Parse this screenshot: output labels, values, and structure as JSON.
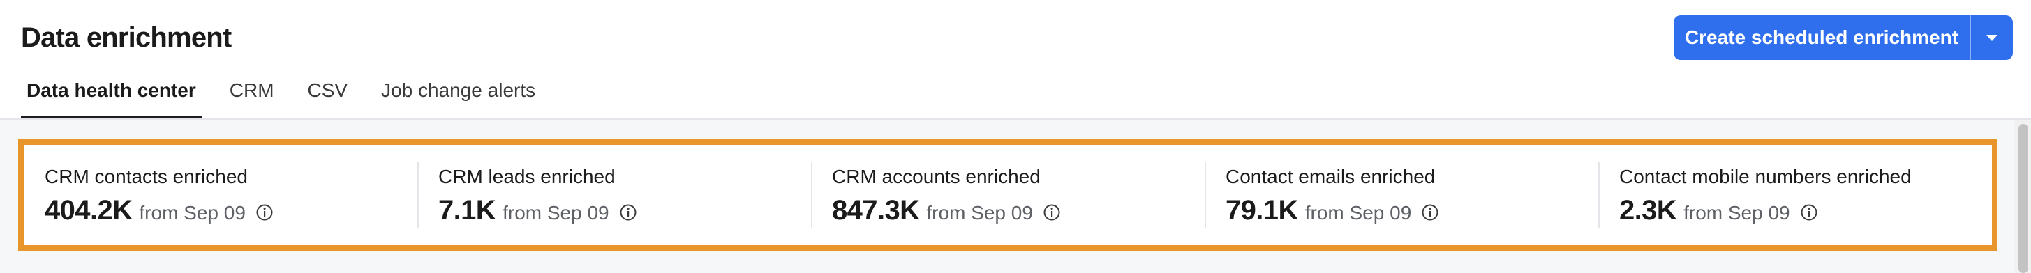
{
  "header": {
    "title": "Data enrichment",
    "create_button": {
      "label": "Create scheduled enrichment",
      "dropdown_icon": "chevron-down-icon",
      "color": "#2f6fed"
    },
    "tabs": [
      {
        "label": "Data health center",
        "active": true
      },
      {
        "label": "CRM",
        "active": false
      },
      {
        "label": "CSV",
        "active": false
      },
      {
        "label": "Job change alerts",
        "active": false
      }
    ]
  },
  "metrics": {
    "highlight_color": "#e8952c",
    "items": [
      {
        "label": "CRM contacts enriched",
        "value": "404.2K",
        "from": "from Sep 09",
        "icon": "info-icon"
      },
      {
        "label": "CRM leads enriched",
        "value": "7.1K",
        "from": "from Sep 09",
        "icon": "info-icon"
      },
      {
        "label": "CRM accounts enriched",
        "value": "847.3K",
        "from": "from Sep 09",
        "icon": "info-icon"
      },
      {
        "label": "Contact emails enriched",
        "value": "79.1K",
        "from": "from Sep 09",
        "icon": "info-icon"
      },
      {
        "label": "Contact mobile numbers enriched",
        "value": "2.3K",
        "from": "from Sep 09",
        "icon": "info-icon"
      }
    ]
  }
}
